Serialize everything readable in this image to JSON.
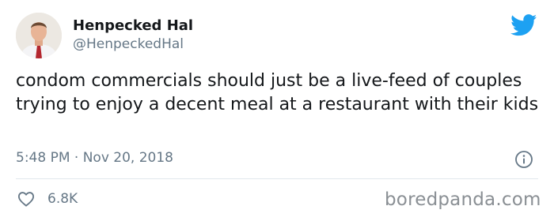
{
  "author": {
    "display_name": "Henpecked Hal",
    "handle": "@HenpeckedHal",
    "avatar_icon": "person-avatar"
  },
  "tweet": {
    "text": "condom commercials should just be a live-feed of couples trying to enjoy a decent meal at a restaurant with their kids",
    "timestamp": "5:48 PM · Nov 20, 2018",
    "likes": "6.8K"
  },
  "icons": {
    "brand": "twitter-bird-icon",
    "info": "info-icon",
    "like": "heart-icon"
  },
  "colors": {
    "twitter_blue": "#1DA1F2",
    "text_primary": "#14171a",
    "text_secondary": "#657786",
    "divider": "#e1e8ed"
  },
  "watermark": "boredpanda.com"
}
